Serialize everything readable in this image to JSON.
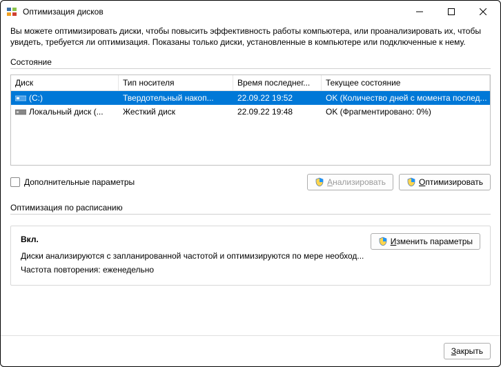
{
  "window": {
    "title": "Оптимизация дисков"
  },
  "description": "Вы можете оптимизировать диски, чтобы повысить эффективность работы  компьютера, или проанализировать их, чтобы увидеть, требуется ли оптимизация. Показаны только диски, установленные в компьютере или подключенные к нему.",
  "status_label": "Состояние",
  "columns": {
    "disk": "Диск",
    "media": "Тип носителя",
    "last": "Время последнег...",
    "state": "Текущее состояние"
  },
  "rows": [
    {
      "name": "(C:)",
      "media": "Твердотельный накоп...",
      "last": "22.09.22 19:52",
      "state": "OK (Количество дней с момента послед..."
    },
    {
      "name": "Локальный диск (...",
      "media": "Жесткий диск",
      "last": "22.09.22 19:48",
      "state": "OK (Фрагментировано: 0%)"
    }
  ],
  "advanced_label": "Дополнительные параметры",
  "buttons": {
    "analyze_pre": "А",
    "analyze_rest": "нализировать",
    "optimize_pre": "О",
    "optimize_rest": "птимизировать",
    "change_pre": "И",
    "change_rest": "зменить параметры",
    "close_pre": "З",
    "close_rest": "акрыть"
  },
  "schedule": {
    "section": "Оптимизация по расписанию",
    "on": "Вкл.",
    "line1": "Диски анализируются с запланированной частотой и оптимизируются по мере необход...",
    "line2": "Частота повторения: еженедельно"
  }
}
